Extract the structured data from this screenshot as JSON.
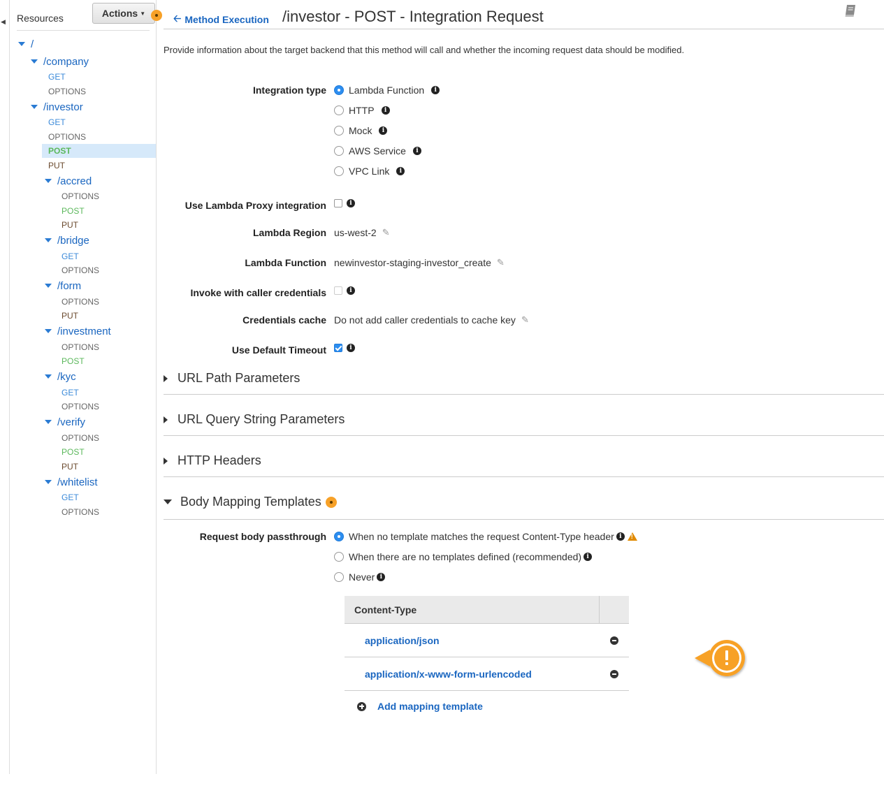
{
  "sidebar": {
    "title": "Resources",
    "actions_label": "Actions",
    "tree": [
      {
        "label": "/",
        "kind": "resource"
      },
      {
        "label": "/company",
        "kind": "resource"
      },
      {
        "label": "GET",
        "kind": "method"
      },
      {
        "label": "OPTIONS",
        "kind": "method"
      },
      {
        "label": "/investor",
        "kind": "resource"
      },
      {
        "label": "GET",
        "kind": "method"
      },
      {
        "label": "OPTIONS",
        "kind": "method"
      },
      {
        "label": "POST",
        "kind": "method",
        "selected": true
      },
      {
        "label": "PUT",
        "kind": "method"
      },
      {
        "label": "/accred",
        "kind": "resource"
      },
      {
        "label": "OPTIONS",
        "kind": "method"
      },
      {
        "label": "POST",
        "kind": "method"
      },
      {
        "label": "PUT",
        "kind": "method"
      },
      {
        "label": "/bridge",
        "kind": "resource"
      },
      {
        "label": "GET",
        "kind": "method"
      },
      {
        "label": "OPTIONS",
        "kind": "method"
      },
      {
        "label": "/form",
        "kind": "resource"
      },
      {
        "label": "OPTIONS",
        "kind": "method"
      },
      {
        "label": "PUT",
        "kind": "method"
      },
      {
        "label": "/investment",
        "kind": "resource"
      },
      {
        "label": "OPTIONS",
        "kind": "method"
      },
      {
        "label": "POST",
        "kind": "method"
      },
      {
        "label": "/kyc",
        "kind": "resource"
      },
      {
        "label": "GET",
        "kind": "method"
      },
      {
        "label": "OPTIONS",
        "kind": "method"
      },
      {
        "label": "/verify",
        "kind": "resource"
      },
      {
        "label": "OPTIONS",
        "kind": "method"
      },
      {
        "label": "POST",
        "kind": "method"
      },
      {
        "label": "PUT",
        "kind": "method"
      },
      {
        "label": "/whitelist",
        "kind": "resource"
      },
      {
        "label": "GET",
        "kind": "method"
      },
      {
        "label": "OPTIONS",
        "kind": "method"
      }
    ]
  },
  "header": {
    "back_label": "Method Execution",
    "title": "/investor - POST - Integration Request"
  },
  "description": "Provide information about the target backend that this method will call and whether the incoming request data should be modified.",
  "form": {
    "integration_type_label": "Integration type",
    "integration_types": [
      {
        "label": "Lambda Function",
        "selected": true
      },
      {
        "label": "HTTP",
        "selected": false
      },
      {
        "label": "Mock",
        "selected": false
      },
      {
        "label": "AWS Service",
        "selected": false
      },
      {
        "label": "VPC Link",
        "selected": false
      }
    ],
    "proxy_label": "Use Lambda Proxy integration",
    "proxy_checked": false,
    "region_label": "Lambda Region",
    "region_value": "us-west-2",
    "function_label": "Lambda Function",
    "function_value": "newinvestor-staging-investor_create",
    "invoke_label": "Invoke with caller credentials",
    "invoke_checked": false,
    "cache_label": "Credentials cache",
    "cache_value": "Do not add caller credentials to cache key",
    "timeout_label": "Use Default Timeout",
    "timeout_checked": true
  },
  "sections": {
    "url_path": "URL Path Parameters",
    "url_query": "URL Query String Parameters",
    "http_headers": "HTTP Headers",
    "body_mapping": "Body Mapping Templates"
  },
  "body_mapping": {
    "passthrough_label": "Request body passthrough",
    "options": [
      {
        "label": "When no template matches the request Content-Type header",
        "selected": true
      },
      {
        "label": "When there are no templates defined (recommended)",
        "selected": false
      },
      {
        "label": "Never",
        "selected": false
      }
    ],
    "table_header": "Content-Type",
    "content_types": [
      "application/json",
      "application/x-www-form-urlencoded"
    ],
    "add_label": "Add mapping template"
  },
  "colors": {
    "link_blue": "#1a66c0",
    "accent_orange": "#f7a128",
    "radio_blue": "#2d8ef0",
    "post_green": "#5cb85c"
  }
}
